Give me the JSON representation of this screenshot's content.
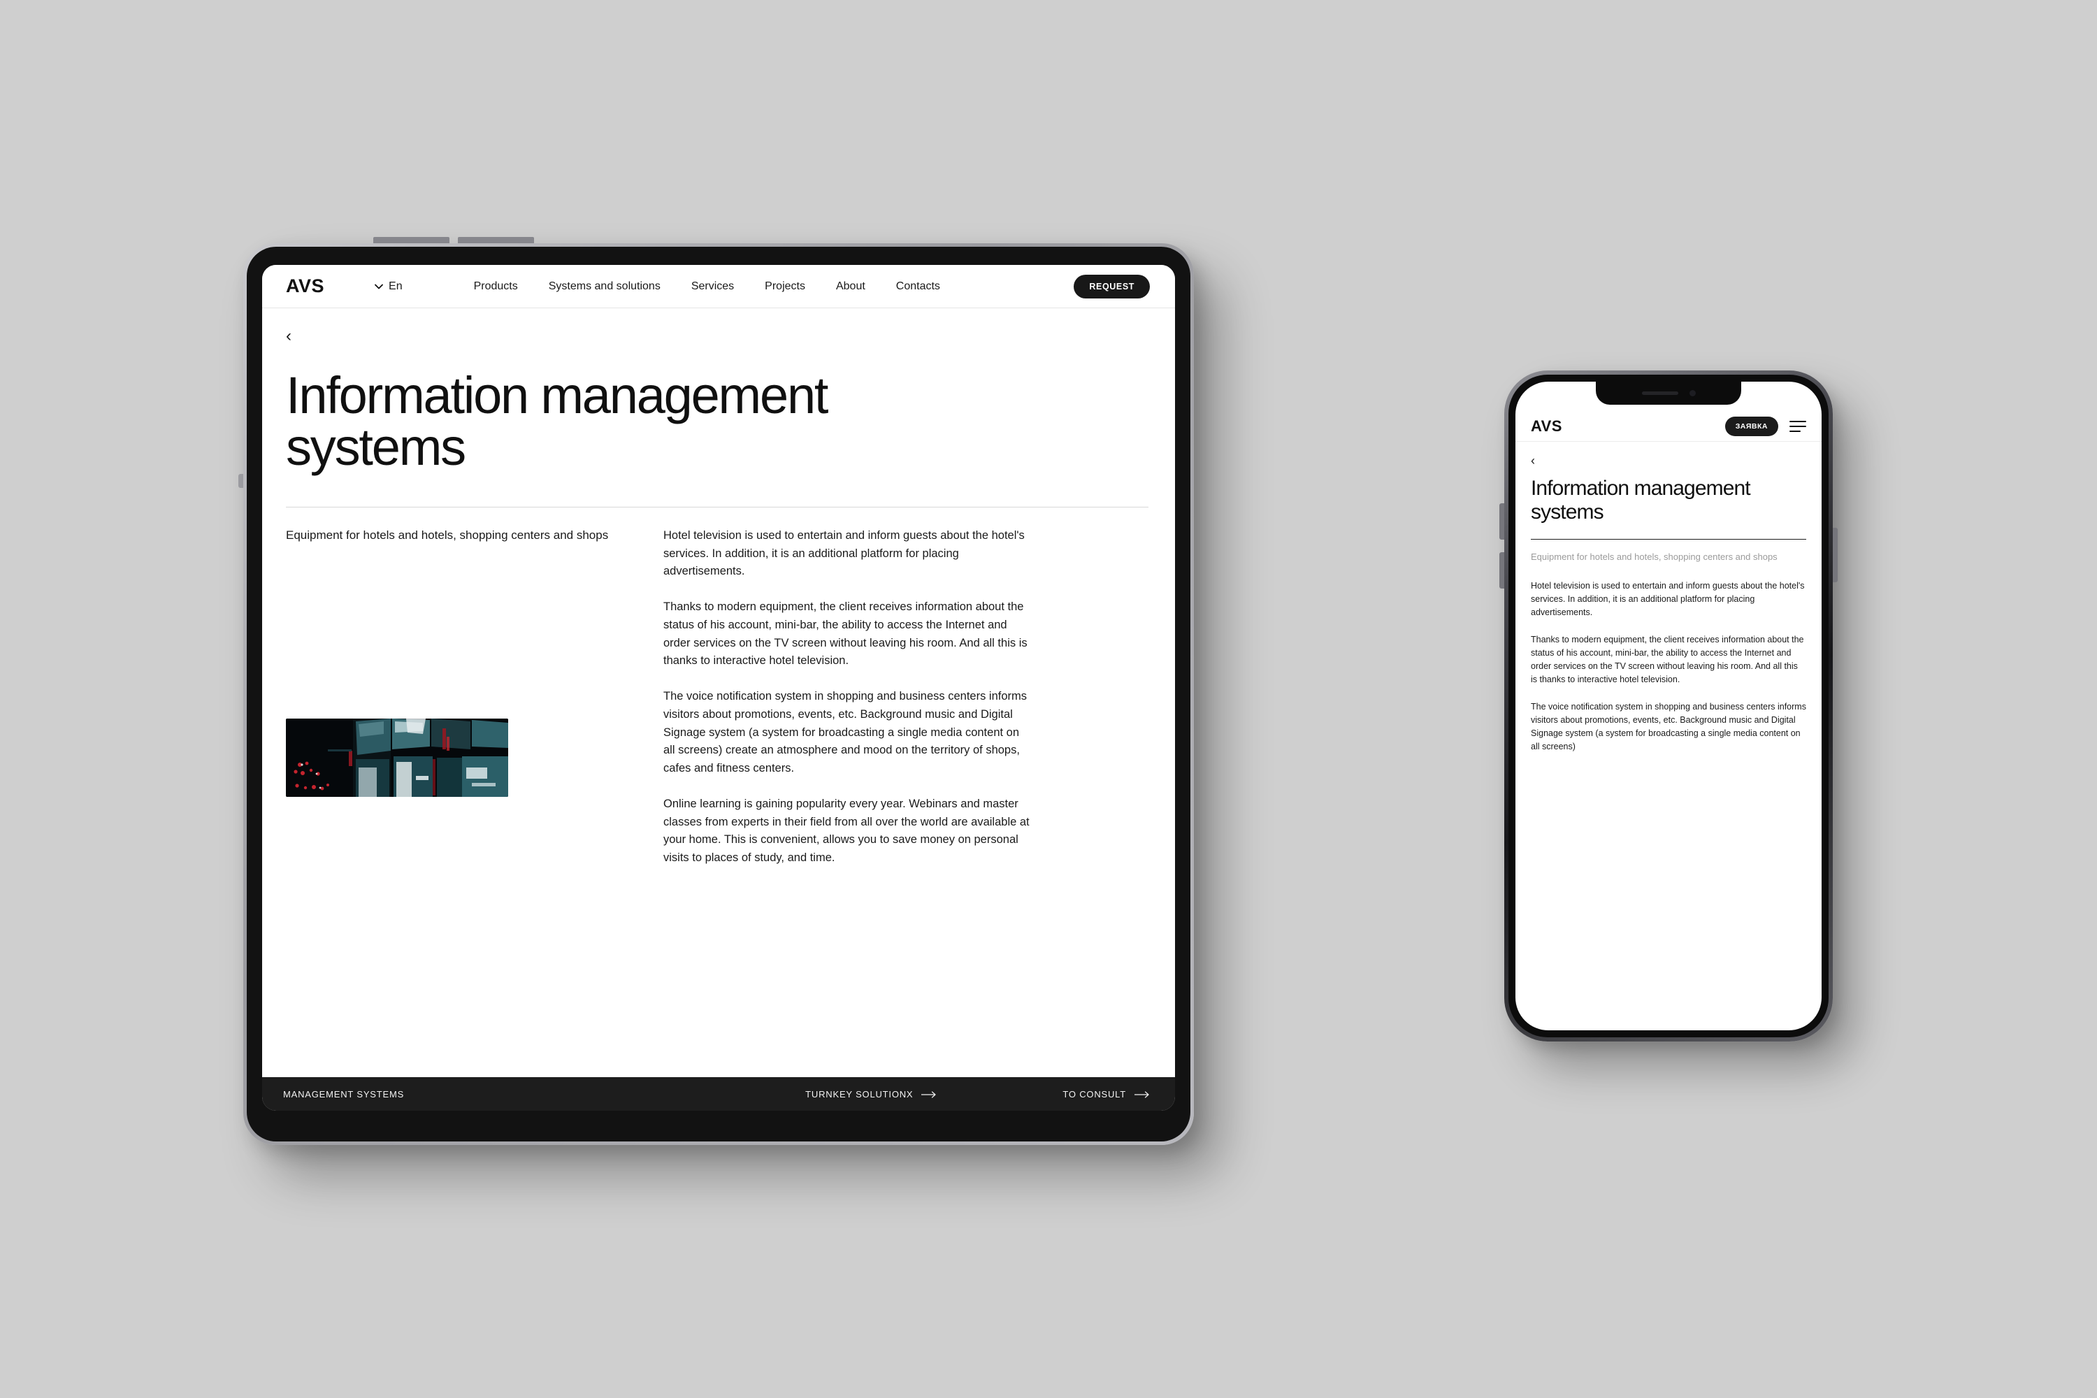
{
  "background_color": "#cfcfcf",
  "brand": {
    "accent_dark": "#181818",
    "text": "#1a1a1a",
    "muted": "#9b9b9b"
  },
  "tablet": {
    "header": {
      "logo": "AVS",
      "language": {
        "value": "En",
        "chevron": "chevron-down-icon"
      },
      "nav": [
        {
          "label": "Products"
        },
        {
          "label": "Systems and solutions"
        },
        {
          "label": "Services"
        },
        {
          "label": "Projects"
        },
        {
          "label": "About"
        },
        {
          "label": "Contacts"
        }
      ],
      "request_label": "REQUEST"
    },
    "back_icon": "‹",
    "title": "Information management systems",
    "lede": "Equipment for hotels and hotels, shopping centers and shops",
    "paragraphs": [
      "Hotel television is used to entertain and inform guests about the hotel's services. In addition, it is an additional platform for placing advertisements.",
      "Thanks to modern equipment, the client receives information about the status of his account, mini-bar, the ability to access the Internet and order services on the TV screen without leaving his room. And all this is thanks to interactive hotel television.",
      "The voice notification system in shopping and business centers informs visitors about promotions, events, etc. Background music and Digital Signage system (a system for broadcasting a single media content on all screens) create an atmosphere and mood on the territory of shops, cafes and fitness centers.",
      "Online learning is gaining popularity every year. Webinars and master classes from experts in their field from all over the world are available at your home. This is convenient, allows you to save money on personal visits to places of study, and time."
    ],
    "footer": {
      "left_label": "MANAGEMENT SYSTEMS",
      "middle_label": "TURNKEY SOLUTIONX",
      "middle_arrow": "arrow-right-icon",
      "right_label": "TO CONSULT",
      "right_arrow": "arrow-right-icon"
    }
  },
  "phone": {
    "header": {
      "logo": "AVS",
      "request_label": "ЗАЯВКА",
      "menu_icon": "hamburger-menu-icon"
    },
    "back_icon": "‹",
    "title": "Information management systems",
    "lede": "Equipment for hotels and hotels, shopping centers and shops",
    "paragraphs": [
      "Hotel television is used to entertain and inform guests about the hotel's services. In addition, it is an additional platform for placing advertisements.",
      "Thanks to modern equipment, the client receives information about the status of his account, mini-bar, the ability to access the Internet and order services on the TV screen without leaving his room. And all this is thanks to interactive hotel television.",
      "The voice notification system in shopping and business centers informs visitors about promotions, events, etc. Background music and Digital Signage system (a system for broadcasting a single media content on all screens)"
    ]
  }
}
